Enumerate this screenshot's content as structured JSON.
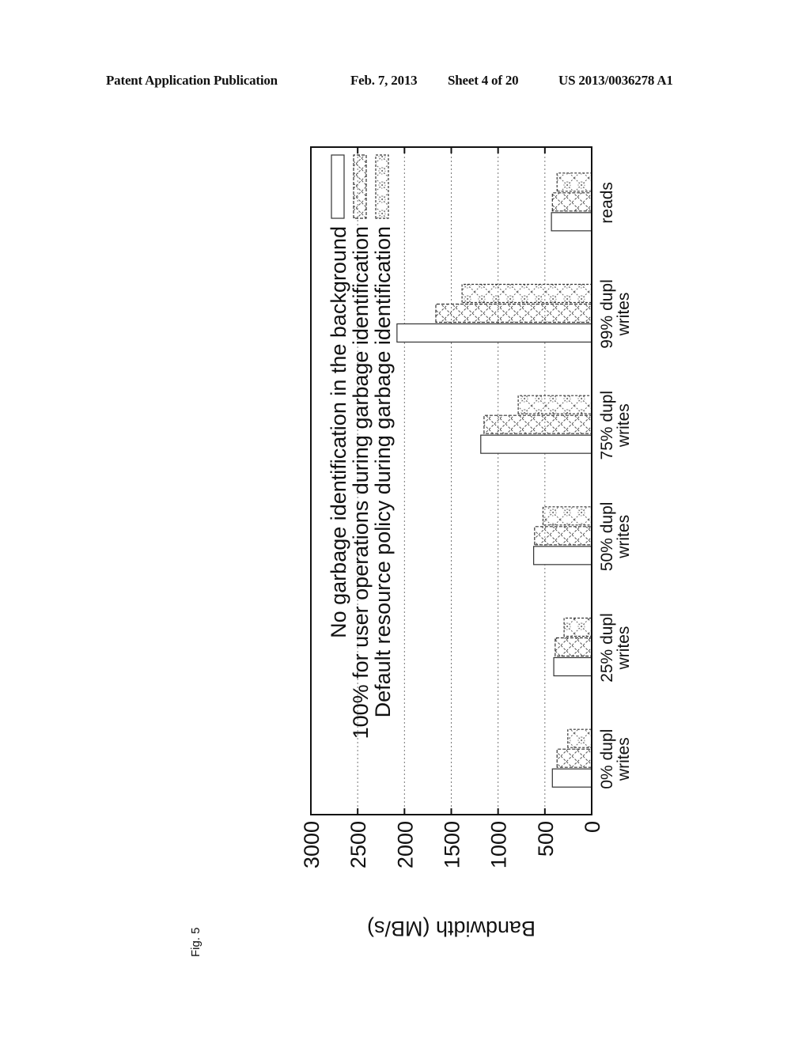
{
  "header": {
    "left": "Patent Application Publication",
    "date": "Feb. 7, 2013",
    "sheet": "Sheet 4 of 20",
    "number": "US 2013/0036278 A1"
  },
  "figure_label": "Fig. 5",
  "chart_data": {
    "type": "bar",
    "orientation": "rotated 90° counter-clockwise on page",
    "title": "",
    "xlabel": "",
    "ylabel": "Bandwidth (MB/s)",
    "ylim": [
      0,
      3000
    ],
    "yticks": [
      "0",
      "500",
      "1000",
      "1500",
      "2000",
      "2500",
      "3000"
    ],
    "grid": true,
    "legend_position": "top (inside plot)",
    "categories": [
      [
        "0% dupl",
        "writes"
      ],
      [
        "25% dupl",
        "writes"
      ],
      [
        "50% dupl",
        "writes"
      ],
      [
        "75% dupl",
        "writes"
      ],
      [
        "99% dupl",
        "writes"
      ],
      [
        "reads"
      ]
    ],
    "series": [
      {
        "name": "No garbage identification in the background",
        "pattern": "plain",
        "values": [
          420,
          405,
          620,
          1185,
          2080,
          430
        ]
      },
      {
        "name": "100% for user operations during garbage identification",
        "pattern": "crosshatch",
        "values": [
          370,
          390,
          610,
          1150,
          1665,
          420
        ]
      },
      {
        "name": "Default resource policy during garbage identification",
        "pattern": "dotted-diamond",
        "values": [
          255,
          295,
          520,
          785,
          1385,
          370
        ]
      }
    ]
  }
}
